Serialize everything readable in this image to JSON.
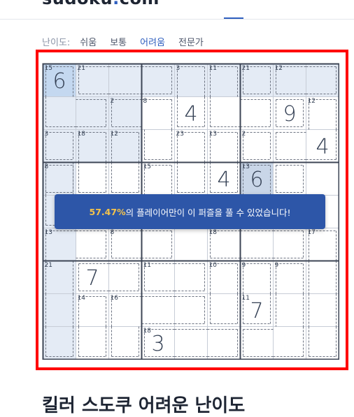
{
  "header": {
    "brand_prefix": "sudoku",
    "brand_dot": ".",
    "brand_suffix": "com"
  },
  "difficulty": {
    "label": "난이도:",
    "options": [
      "쉬움",
      "보통",
      "어려움",
      "전문가"
    ],
    "selected": "어려움"
  },
  "board": {
    "values": [
      {
        "r": 0,
        "c": 0,
        "v": "6"
      },
      {
        "r": 1,
        "c": 4,
        "v": "4"
      },
      {
        "r": 1,
        "c": 7,
        "v": "9"
      },
      {
        "r": 2,
        "c": 8,
        "v": "4"
      },
      {
        "r": 3,
        "c": 5,
        "v": "4"
      },
      {
        "r": 3,
        "c": 6,
        "v": "6"
      },
      {
        "r": 6,
        "c": 1,
        "v": "7"
      },
      {
        "r": 7,
        "c": 6,
        "v": "7"
      },
      {
        "r": 8,
        "c": 3,
        "v": "3"
      }
    ],
    "cage_sums": [
      {
        "r": 0,
        "c": 0,
        "s": "15"
      },
      {
        "r": 0,
        "c": 1,
        "s": "21"
      },
      {
        "r": 0,
        "c": 4,
        "s": "3"
      },
      {
        "r": 0,
        "c": 5,
        "s": "11"
      },
      {
        "r": 0,
        "c": 6,
        "s": "21"
      },
      {
        "r": 0,
        "c": 7,
        "s": "12"
      },
      {
        "r": 1,
        "c": 2,
        "s": "2"
      },
      {
        "r": 1,
        "c": 3,
        "s": "8"
      },
      {
        "r": 1,
        "c": 8,
        "s": "12"
      },
      {
        "r": 2,
        "c": 0,
        "s": "3"
      },
      {
        "r": 2,
        "c": 1,
        "s": "18"
      },
      {
        "r": 2,
        "c": 2,
        "s": "12"
      },
      {
        "r": 2,
        "c": 4,
        "s": "23"
      },
      {
        "r": 2,
        "c": 5,
        "s": "13"
      },
      {
        "r": 2,
        "c": 6,
        "s": "2"
      },
      {
        "r": 3,
        "c": 0,
        "s": "8"
      },
      {
        "r": 3,
        "c": 3,
        "s": "15"
      },
      {
        "r": 3,
        "c": 6,
        "s": "13"
      },
      {
        "r": 5,
        "c": 0,
        "s": "13"
      },
      {
        "r": 5,
        "c": 2,
        "s": "8"
      },
      {
        "r": 5,
        "c": 5,
        "s": "18"
      },
      {
        "r": 5,
        "c": 8,
        "s": "17"
      },
      {
        "r": 6,
        "c": 0,
        "s": "21"
      },
      {
        "r": 6,
        "c": 3,
        "s": "11"
      },
      {
        "r": 6,
        "c": 5,
        "s": "10"
      },
      {
        "r": 6,
        "c": 6,
        "s": "9"
      },
      {
        "r": 6,
        "c": 7,
        "s": "9"
      },
      {
        "r": 7,
        "c": 1,
        "s": "14"
      },
      {
        "r": 7,
        "c": 2,
        "s": "16"
      },
      {
        "r": 7,
        "c": 6,
        "s": "11"
      },
      {
        "r": 8,
        "c": 3,
        "s": "18"
      }
    ],
    "cages": [
      [
        [
          0,
          0
        ],
        [
          1,
          0
        ],
        [
          1,
          1
        ]
      ],
      [
        [
          0,
          1
        ],
        [
          0,
          2
        ],
        [
          0,
          3
        ]
      ],
      [
        [
          0,
          4
        ],
        [
          1,
          4
        ]
      ],
      [
        [
          0,
          5
        ],
        [
          1,
          5
        ],
        [
          1,
          6
        ]
      ],
      [
        [
          0,
          6
        ],
        [
          1,
          7
        ]
      ],
      [
        [
          0,
          7
        ],
        [
          0,
          8
        ]
      ],
      [
        [
          1,
          2
        ],
        [
          1,
          3
        ],
        [
          2,
          3
        ]
      ],
      [
        [
          1,
          8
        ],
        [
          2,
          7
        ],
        [
          2,
          8
        ]
      ],
      [
        [
          2,
          0
        ],
        [
          3,
          0
        ]
      ],
      [
        [
          2,
          1
        ],
        [
          3,
          1
        ]
      ],
      [
        [
          2,
          2
        ],
        [
          3,
          2
        ]
      ],
      [
        [
          2,
          4
        ],
        [
          3,
          4
        ]
      ],
      [
        [
          2,
          5
        ],
        [
          3,
          5
        ]
      ],
      [
        [
          2,
          6
        ],
        [
          3,
          7
        ]
      ],
      [
        [
          3,
          0
        ],
        [
          4,
          0
        ]
      ],
      [
        [
          3,
          3
        ],
        [
          4,
          3
        ]
      ],
      [
        [
          3,
          6
        ],
        [
          4,
          6
        ],
        [
          4,
          7
        ]
      ],
      [
        [
          5,
          0
        ],
        [
          5,
          1
        ],
        [
          6,
          0
        ],
        [
          7,
          0
        ],
        [
          8,
          0
        ]
      ],
      [
        [
          5,
          2
        ],
        [
          5,
          3
        ]
      ],
      [
        [
          5,
          5
        ],
        [
          5,
          6
        ],
        [
          5,
          7
        ]
      ],
      [
        [
          5,
          8
        ],
        [
          6,
          8
        ],
        [
          7,
          8
        ],
        [
          8,
          8
        ]
      ],
      [
        [
          6,
          1
        ],
        [
          6,
          2
        ]
      ],
      [
        [
          6,
          3
        ],
        [
          6,
          4
        ]
      ],
      [
        [
          6,
          5
        ],
        [
          7,
          5
        ]
      ],
      [
        [
          6,
          6
        ],
        [
          7,
          6
        ]
      ],
      [
        [
          6,
          7
        ],
        [
          7,
          7
        ],
        [
          8,
          6
        ],
        [
          8,
          7
        ]
      ],
      [
        [
          7,
          1
        ],
        [
          8,
          1
        ]
      ],
      [
        [
          7,
          2
        ],
        [
          7,
          3
        ],
        [
          7,
          4
        ],
        [
          8,
          2
        ]
      ],
      [
        [
          8,
          3
        ],
        [
          8,
          4
        ],
        [
          8,
          5
        ]
      ]
    ],
    "highlight_cells": [
      [
        0,
        1
      ],
      [
        0,
        2
      ],
      [
        0,
        3
      ],
      [
        0,
        4
      ],
      [
        0,
        5
      ],
      [
        0,
        6
      ],
      [
        0,
        7
      ],
      [
        0,
        8
      ],
      [
        1,
        0
      ],
      [
        1,
        1
      ],
      [
        1,
        2
      ],
      [
        2,
        0
      ],
      [
        2,
        1
      ],
      [
        2,
        2
      ],
      [
        3,
        0
      ],
      [
        4,
        0
      ],
      [
        5,
        0
      ],
      [
        6,
        0
      ],
      [
        7,
        0
      ],
      [
        8,
        0
      ]
    ],
    "selected_cell": [
      0,
      0
    ],
    "same_value_cells": [
      [
        3,
        6
      ]
    ]
  },
  "stats_banner": {
    "percent": "57.47%",
    "message": "의 플레이어만이 이 퍼즐을 풀 수 있었습니다!"
  },
  "page_heading": "킬러 스도쿠 어려운 난이도"
}
